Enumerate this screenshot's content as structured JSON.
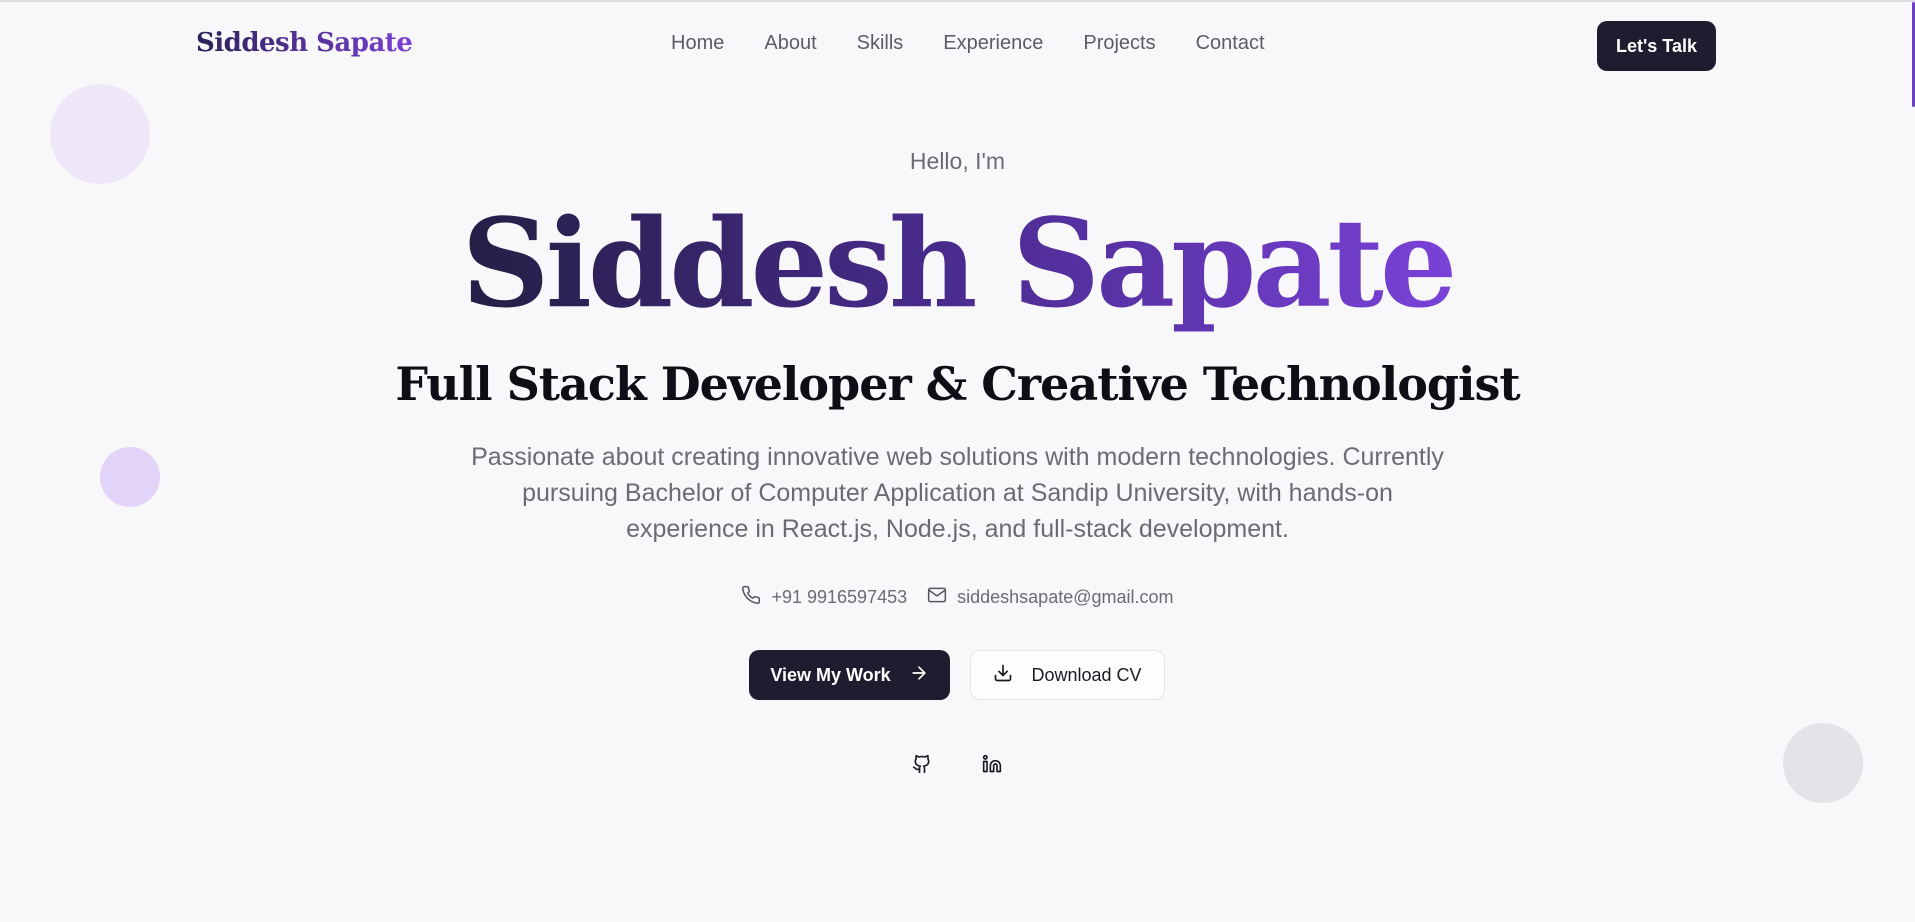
{
  "nav": {
    "logo": "Siddesh Sapate",
    "links": [
      "Home",
      "About",
      "Skills",
      "Experience",
      "Projects",
      "Contact"
    ],
    "cta_label": "Let's Talk"
  },
  "hero": {
    "greeting": "Hello, I'm",
    "name": "Siddesh Sapate",
    "subtitle": "Full Stack Developer & Creative Technologist",
    "description": "Passionate about creating innovative web solutions with modern technologies. Currently pursuing Bachelor of Computer Application at Sandip University, with hands-on experience in React.js, Node.js, and full-stack development.",
    "phone": "+91 9916597453",
    "email": "siddeshsapate@gmail.com",
    "primary_button": "View My Work",
    "secondary_button": "Download CV",
    "socials": [
      "github-icon",
      "linkedin-icon"
    ]
  },
  "colors": {
    "accent": "#7b3fd6",
    "dark": "#1e1d30",
    "background": "#f8f8fa",
    "muted_text": "#6b6b73"
  }
}
